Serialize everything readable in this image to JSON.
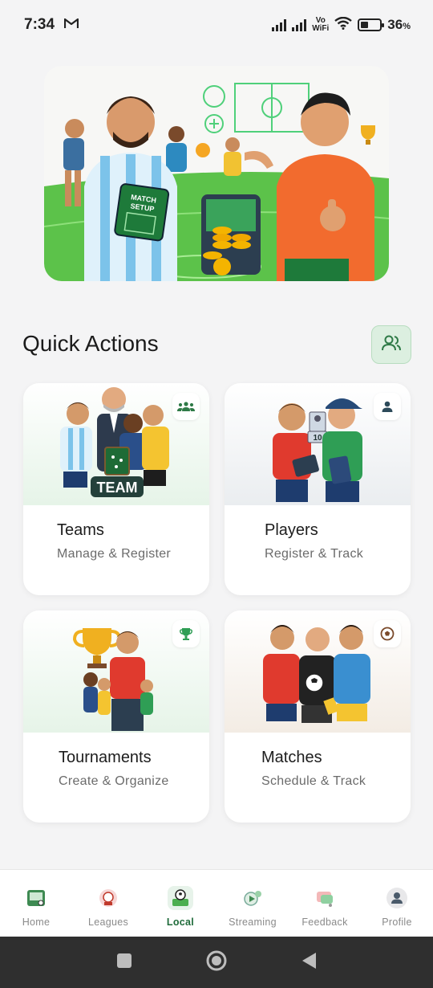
{
  "status_bar": {
    "time": "7:34",
    "network_label_top": "Vo",
    "network_label_bottom": "WiFi",
    "battery_percent": "36",
    "battery_symbol": "%"
  },
  "hero": {
    "board_text_line1": "MATCH",
    "board_text_line2": "SETUP"
  },
  "quick_actions": {
    "title": "Quick Actions",
    "cards": [
      {
        "title": "Teams",
        "subtitle": "Manage & Register",
        "art_label": "TEAM",
        "icon": "people-icon"
      },
      {
        "title": "Players",
        "subtitle": "Register & Track",
        "art_label": "10",
        "icon": "person-icon"
      },
      {
        "title": "Tournaments",
        "subtitle": "Create & Organize",
        "icon": "trophy-icon"
      },
      {
        "title": "Matches",
        "subtitle": "Schedule & Track",
        "icon": "soccer-ball-icon"
      }
    ]
  },
  "bottom_nav": {
    "items": [
      {
        "label": "Home",
        "icon": "home-icon"
      },
      {
        "label": "Leagues",
        "icon": "leagues-icon"
      },
      {
        "label": "Local",
        "icon": "local-icon",
        "active": true
      },
      {
        "label": "Streaming",
        "icon": "streaming-icon"
      },
      {
        "label": "Feedback",
        "icon": "feedback-icon"
      },
      {
        "label": "Profile",
        "icon": "profile-icon"
      }
    ]
  },
  "colors": {
    "accent_green": "#1f6b3a",
    "background": "#f4f4f5",
    "card": "#ffffff"
  }
}
